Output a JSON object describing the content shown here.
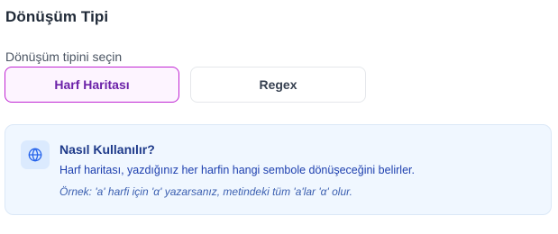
{
  "section": {
    "title": "Dönüşüm Tipi"
  },
  "conversion_type": {
    "label": "Dönüşüm tipini seçin",
    "options": [
      {
        "label": "Harf Haritası",
        "selected": true
      },
      {
        "label": "Regex",
        "selected": false
      }
    ]
  },
  "info": {
    "icon": "globe-icon",
    "title": "Nasıl Kullanılır?",
    "description": "Harf haritası, yazdığınız her harfin hangi sembole dönüşeceğini belirler.",
    "example": "Örnek: 'a' harfi için 'α' yazarsanız, metindeki tüm 'a'lar 'α' olur."
  },
  "colors": {
    "accent": "#c026d3",
    "accent_bg": "#fdf4ff",
    "accent_text": "#6b21a8",
    "info_bg": "#f0f7ff",
    "info_text": "#1e40af"
  }
}
